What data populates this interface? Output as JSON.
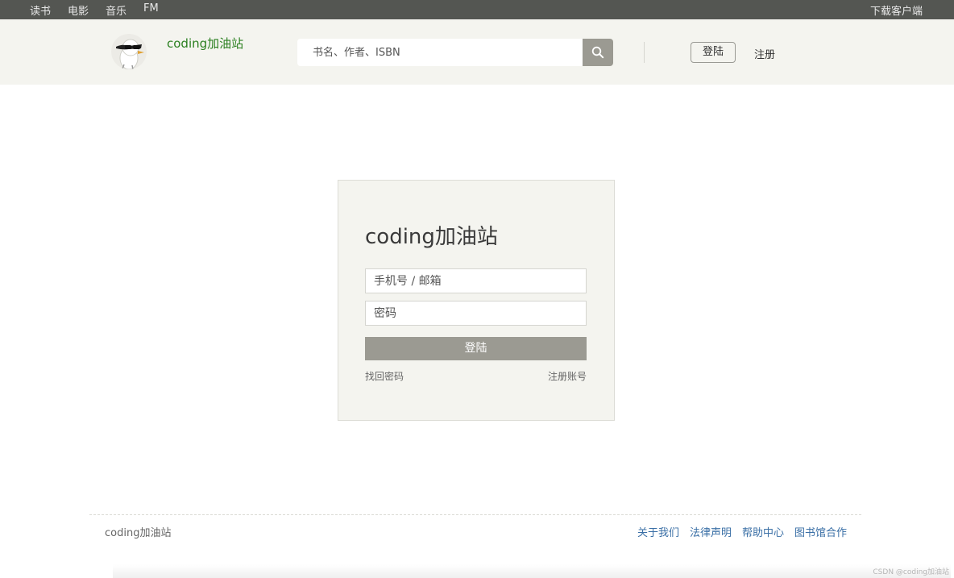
{
  "topbar": {
    "nav": [
      "读书",
      "电影",
      "音乐",
      "FM"
    ],
    "download": "下载客户端"
  },
  "header": {
    "brand": "coding加油站",
    "search_placeholder": "书名、作者、ISBN",
    "login": "登陆",
    "register": "注册"
  },
  "login_card": {
    "title": "coding加油站",
    "account_placeholder": "手机号 / 邮箱",
    "password_placeholder": "密码",
    "submit": "登陆",
    "forgot": "找回密码",
    "signup": "注册账号"
  },
  "footer": {
    "brand": "coding加油站",
    "links": [
      "关于我们",
      "法律声明",
      "帮助中心",
      "图书馆合作"
    ]
  },
  "watermark": "CSDN @coding加油站",
  "colors": {
    "topbar_bg": "#545652",
    "header_bg": "#f4f4ef",
    "brand_green": "#2a7f1f",
    "button_gray": "#9b9a92",
    "link_blue": "#3a6fa6"
  }
}
